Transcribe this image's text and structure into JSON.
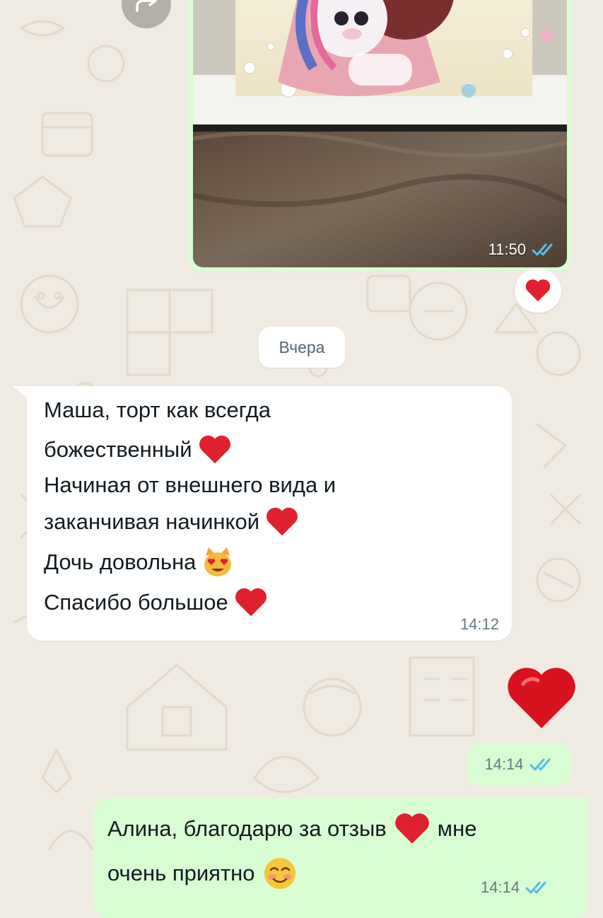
{
  "chat": {
    "photo_message": {
      "time": "11:50",
      "reaction": "heart"
    },
    "date_separator": "Вчера",
    "incoming": {
      "lines": [
        "Маша, торт как всегда",
        "божественный",
        "Начиная от внешнего вида и",
        "заканчивая начинкой",
        "Дочь довольна",
        "Спасибо большое"
      ],
      "time": "14:12"
    },
    "outgoing_heart": {
      "time": "14:14"
    },
    "outgoing_reply": {
      "line1_a": "Алина, благодарю за отзыв",
      "line1_b": "мне",
      "line2": "очень приятно",
      "time": "14:14"
    }
  },
  "colors": {
    "outgoing_bubble": "#d9fdd3",
    "incoming_bubble": "#ffffff",
    "chat_background": "#efeae2",
    "read_ticks": "#53bdeb"
  },
  "icons": [
    "forward-icon",
    "double-check-icon",
    "heart-emoji",
    "heart-eyes-cat-emoji",
    "smiling-blush-emoji"
  ]
}
